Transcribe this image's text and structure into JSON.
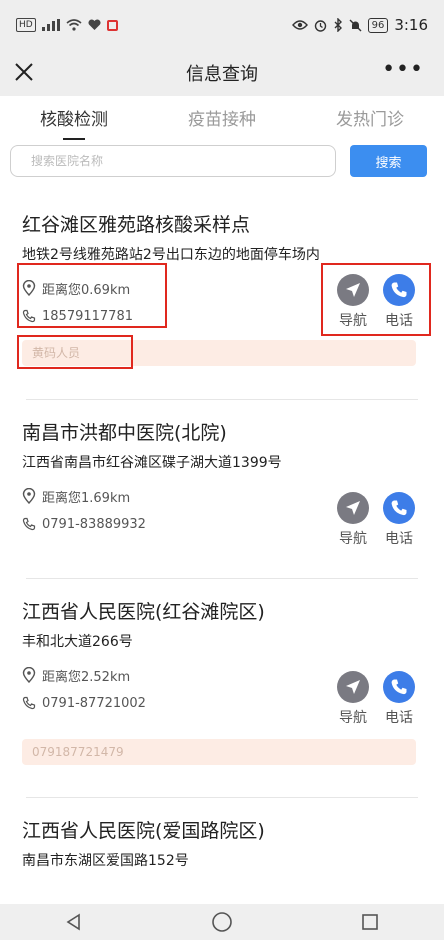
{
  "status_bar": {
    "left_badge": "HD",
    "battery": "96",
    "time": "3:16"
  },
  "nav": {
    "title": "信息查询"
  },
  "tabs": [
    {
      "label": "核酸检测",
      "active": true
    },
    {
      "label": "疫苗接种",
      "active": false
    },
    {
      "label": "发热门诊",
      "active": false
    }
  ],
  "search": {
    "placeholder": "搜索医院名称",
    "value": "",
    "button_label": "搜索"
  },
  "actions": {
    "navigate_label": "导航",
    "phone_label": "电话"
  },
  "sites": [
    {
      "name": "红谷滩区雅苑路核酸采样点",
      "address": "地铁2号线雅苑路站2号出口东边的地面停车场内",
      "distance": "距离您0.69km",
      "phone": "18579117781",
      "tag": "黄码人员"
    },
    {
      "name": "南昌市洪都中医院(北院)",
      "address": "江西省南昌市红谷滩区碟子湖大道1399号",
      "distance": "距离您1.69km",
      "phone": "0791-83889932",
      "tag": ""
    },
    {
      "name": "江西省人民医院(红谷滩院区)",
      "address": "丰和北大道266号",
      "distance": "距离您2.52km",
      "phone": "0791-87721002",
      "tag": "079187721479"
    },
    {
      "name": "江西省人民医院(爱国路院区)",
      "address": "南昌市东湖区爱国路152号",
      "distance": "",
      "phone": "",
      "tag": ""
    }
  ],
  "colors": {
    "accent_blue": "#3c8ef0",
    "phone_blue": "#3d7de8",
    "nav_gray": "#7a7a82",
    "tag_bg": "#fdece4",
    "highlight_red": "#e0281e"
  }
}
